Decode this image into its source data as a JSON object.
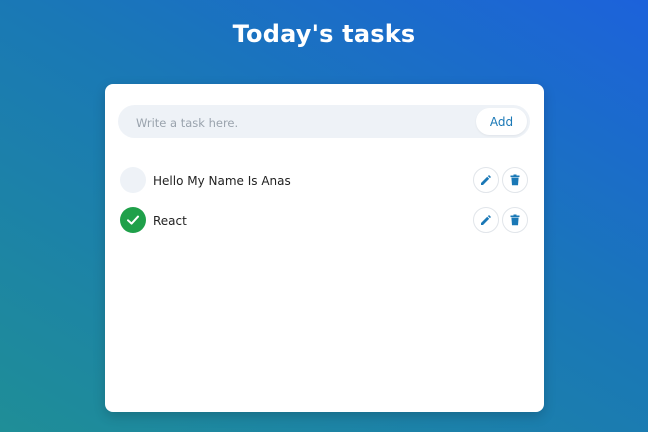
{
  "header": {
    "title": "Today's tasks"
  },
  "input": {
    "placeholder": "Write a task here.",
    "value": "",
    "add_label": "Add"
  },
  "tasks": [
    {
      "label": "Hello My Name Is Anas",
      "completed": false
    },
    {
      "label": "React",
      "completed": true
    }
  ],
  "colors": {
    "accent": "#1a78b6",
    "complete": "#1fa04a",
    "gradient_top": "#1c62db",
    "gradient_bottom": "#1f8e97"
  },
  "icons": [
    "check-icon",
    "pencil-icon",
    "trash-icon"
  ]
}
